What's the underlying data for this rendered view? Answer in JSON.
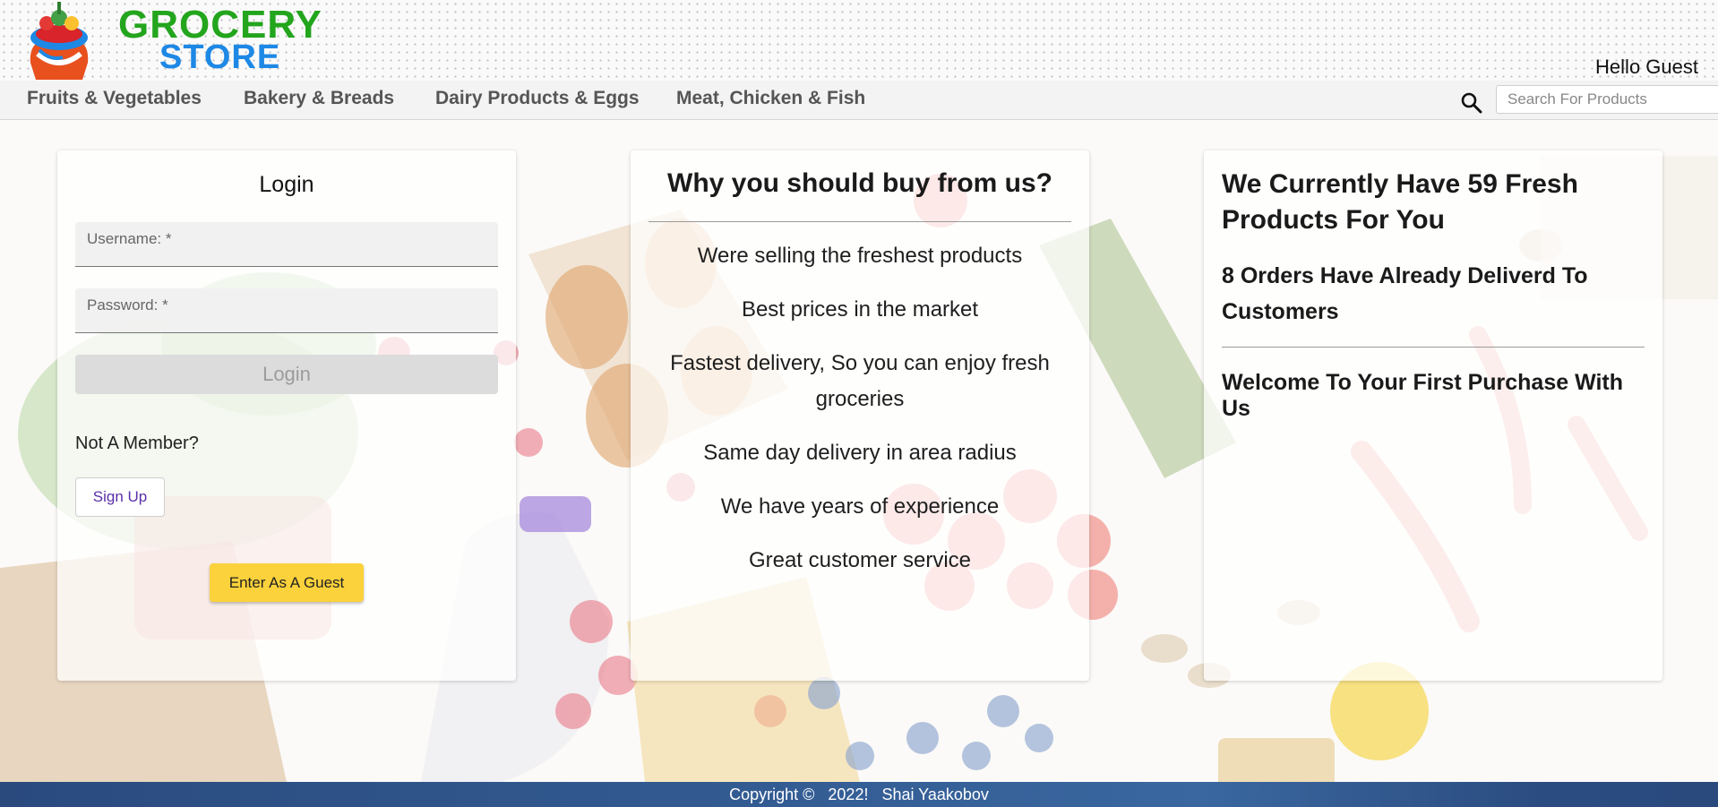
{
  "header": {
    "brand_line1": "GROCERY",
    "brand_line2": "STORE",
    "greeting": "Hello Guest"
  },
  "nav": {
    "items": [
      {
        "label": "Fruits & Vegetables"
      },
      {
        "label": "Bakery & Breads"
      },
      {
        "label": "Dairy Products & Eggs"
      },
      {
        "label": "Meat, Chicken & Fish"
      }
    ],
    "search_placeholder": "Search For Products",
    "search_icon": "search-icon"
  },
  "login": {
    "title": "Login",
    "username_label": "Username: *",
    "password_label": "Password: *",
    "login_button": "Login",
    "not_member": "Not A Member?",
    "signup_button": "Sign Up",
    "guest_button": "Enter As A Guest"
  },
  "why": {
    "title": "Why you should buy from us?",
    "items": [
      "Were selling the freshest products",
      "Best prices in the market",
      "Fastest delivery, So you can enjoy fresh groceries",
      "Same day delivery in area radius",
      "We have years of experience",
      "Great customer service"
    ]
  },
  "stats": {
    "products_text": "We Currently Have 59 Fresh Products For You",
    "orders_text": "8 Orders Have Already Deliverd To Customers",
    "welcome_text": "Welcome To Your First Purchase With Us"
  },
  "footer": {
    "copyright": "Copyright ©   2022!   Shai Yaakobov"
  },
  "colors": {
    "brand_green": "#23a51d",
    "brand_blue": "#1e88e5",
    "guest_button": "#fbd23b",
    "footer": "#2f5590"
  }
}
